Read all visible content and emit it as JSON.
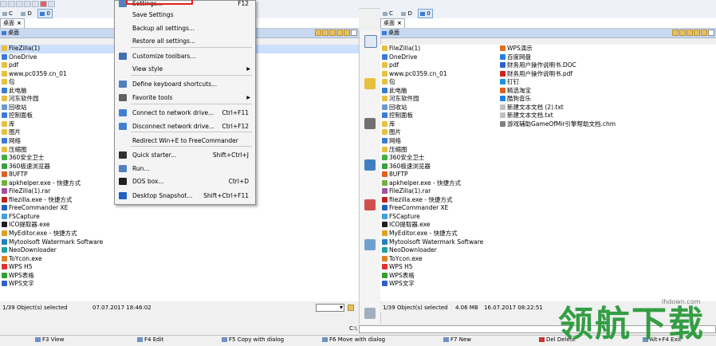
{
  "left_panel": {
    "drives": [
      "C",
      "D",
      "0"
    ],
    "tab": "桌面",
    "path": "桌面",
    "files": [
      {
        "name": "FileZilla(1)",
        "color": "#e8c040"
      },
      {
        "name": "OneDrive",
        "color": "#3a7bd5"
      },
      {
        "name": "pdf",
        "color": "#e8c040"
      },
      {
        "name": "www.pc0359.cn_01",
        "color": "#e8c040"
      },
      {
        "name": "包",
        "color": "#e8c040"
      },
      {
        "name": "此电脑",
        "color": "#3a7bd5"
      },
      {
        "name": "河东软件园",
        "color": "#e8c040"
      },
      {
        "name": "回收站",
        "color": "#6a9ad0"
      },
      {
        "name": "控制面板",
        "color": "#3a7bd5"
      },
      {
        "name": "库",
        "color": "#e8c040"
      },
      {
        "name": "图片",
        "color": "#e8c040"
      },
      {
        "name": "网络",
        "color": "#3a7bd5"
      },
      {
        "name": "压缩图",
        "color": "#e8c040"
      },
      {
        "name": "360安全卫士",
        "color": "#40b040"
      },
      {
        "name": "360极速浏览器",
        "color": "#3aa040"
      },
      {
        "name": "8UFTP",
        "color": "#e06020"
      },
      {
        "name": "apkhelper.exe - 快捷方式",
        "color": "#70b040"
      },
      {
        "name": "FileZilla(1).rar",
        "color": "#a050a0"
      },
      {
        "name": "filezilla.exe - 快捷方式",
        "color": "#c02020"
      },
      {
        "name": "FreeCommander XE",
        "color": "#2060c0"
      },
      {
        "name": "FSCapture",
        "color": "#40a0e0"
      },
      {
        "name": "ICO提取器.exe",
        "color": "#202020"
      },
      {
        "name": "MyEditor.exe - 快捷方式",
        "color": "#e0a020"
      },
      {
        "name": "Mytoolsoft Watermark Software",
        "color": "#2080c0"
      },
      {
        "name": "NeoDownloader",
        "color": "#20a0a0"
      },
      {
        "name": "ToYcon.exe",
        "color": "#e08020"
      },
      {
        "name": "WPS H5",
        "color": "#e03030"
      },
      {
        "name": "WPS表格",
        "color": "#30a030"
      },
      {
        "name": "WPS文字",
        "color": "#3060d0"
      }
    ],
    "status": "1/39 Object(s) selected",
    "date": "07.07.2017 18:46:02"
  },
  "right_panel": {
    "drives": [
      "C",
      "D",
      "0"
    ],
    "tab": "桌面",
    "path": "桌面",
    "files_col1": [
      {
        "name": "FileZilla(1)",
        "color": "#e8c040"
      },
      {
        "name": "OneDrive",
        "color": "#3a7bd5"
      },
      {
        "name": "pdf",
        "color": "#e8c040"
      },
      {
        "name": "www.pc0359.cn_01",
        "color": "#e8c040"
      },
      {
        "name": "包",
        "color": "#e8c040"
      },
      {
        "name": "此电脑",
        "color": "#3a7bd5"
      },
      {
        "name": "河东软件园",
        "color": "#e8c040"
      },
      {
        "name": "回收站",
        "color": "#6a9ad0"
      },
      {
        "name": "控制面板",
        "color": "#3a7bd5"
      },
      {
        "name": "库",
        "color": "#e8c040"
      },
      {
        "name": "图片",
        "color": "#e8c040"
      },
      {
        "name": "网络",
        "color": "#3a7bd5"
      },
      {
        "name": "压缩图",
        "color": "#e8c040"
      },
      {
        "name": "360安全卫士",
        "color": "#40b040"
      },
      {
        "name": "360极速浏览器",
        "color": "#3aa040"
      },
      {
        "name": "8UFTP",
        "color": "#e06020"
      },
      {
        "name": "apkhelper.exe - 快捷方式",
        "color": "#70b040"
      },
      {
        "name": "FileZilla(1).rar",
        "color": "#a050a0"
      },
      {
        "name": "filezilla.exe - 快捷方式",
        "color": "#c02020"
      },
      {
        "name": "FreeCommander XE",
        "color": "#2060c0"
      },
      {
        "name": "FSCapture",
        "color": "#40a0e0"
      },
      {
        "name": "ICO提取器.exe",
        "color": "#202020"
      },
      {
        "name": "MyEditor.exe - 快捷方式",
        "color": "#e0a020"
      },
      {
        "name": "Mytoolsoft Watermark Software",
        "color": "#2080c0"
      },
      {
        "name": "NeoDownloader",
        "color": "#20a0a0"
      },
      {
        "name": "ToYcon.exe",
        "color": "#e08020"
      },
      {
        "name": "WPS H5",
        "color": "#e03030"
      },
      {
        "name": "WPS表格",
        "color": "#30a030"
      },
      {
        "name": "WPS文字",
        "color": "#3060d0"
      }
    ],
    "files_col2": [
      {
        "name": "WPS演示",
        "color": "#e07020"
      },
      {
        "name": "百度网盘",
        "color": "#2080e0"
      },
      {
        "name": "财务用户操作说明书.DOC",
        "color": "#3060d0"
      },
      {
        "name": "财务用户操作说明书.pdf",
        "color": "#d02020"
      },
      {
        "name": "钉钉",
        "color": "#2090e0"
      },
      {
        "name": "精选淘宝",
        "color": "#e06020"
      },
      {
        "name": "酷狗音乐",
        "color": "#2080e0"
      },
      {
        "name": "新建文本文档 (2).txt",
        "color": "#c0c0c0"
      },
      {
        "name": "新建文本文档.txt",
        "color": "#c0c0c0"
      },
      {
        "name": "游戏辅助GameOfMir引擎帮助文档.chm",
        "color": "#808080"
      }
    ],
    "status": "1/39 Object(s) selected",
    "size": "4.06 MB",
    "date": "16.07.2017 08:22:51"
  },
  "menu": {
    "items": [
      {
        "label": "Settings...",
        "shortcut": "F12",
        "color": "#5080c0"
      },
      {
        "label": "Save Settings",
        "shortcut": "",
        "color": ""
      },
      {
        "label": "Backup all settings...",
        "shortcut": "",
        "color": ""
      },
      {
        "label": "Restore all settings...",
        "shortcut": "",
        "color": ""
      },
      {
        "label": "Customize toolbars...",
        "shortcut": "",
        "color": "#4070b0"
      },
      {
        "label": "View style",
        "shortcut": "",
        "color": "",
        "submenu": true
      },
      {
        "label": "Define keyboard shortcuts...",
        "shortcut": "",
        "color": "#5080c0"
      },
      {
        "label": "Favorite tools",
        "shortcut": "",
        "color": "#606060",
        "submenu": true
      },
      {
        "label": "Connect to network drive...",
        "shortcut": "Ctrl+F11",
        "color": "#4080d0"
      },
      {
        "label": "Disconnect network drive...",
        "shortcut": "Ctrl+F12",
        "color": "#4080d0"
      },
      {
        "label": "Redirect Win+E to FreeCommander",
        "shortcut": "",
        "color": ""
      },
      {
        "label": "Quick starter...",
        "shortcut": "Shift+Ctrl+J",
        "color": "#303030"
      },
      {
        "label": "Run...",
        "shortcut": "",
        "color": "#5080c0"
      },
      {
        "label": "DOS box...",
        "shortcut": "Ctrl+D",
        "color": "#202020"
      },
      {
        "label": "Desktop Snapshot...",
        "shortcut": "Shift+Ctrl+F11",
        "color": "#2060c0"
      }
    ]
  },
  "cmdline": {
    "prompt": "C:\\"
  },
  "function_keys": [
    {
      "label": "F3 View"
    },
    {
      "label": "F4 Edit"
    },
    {
      "label": "F5 Copy with dialog"
    },
    {
      "label": "F6 Move with dialog"
    },
    {
      "label": "F7 New"
    },
    {
      "label": "Del Delete"
    },
    {
      "label": "Alt+F4 Exit"
    }
  ],
  "watermark": {
    "text": "领航下载",
    "url": "lhdown.com"
  }
}
